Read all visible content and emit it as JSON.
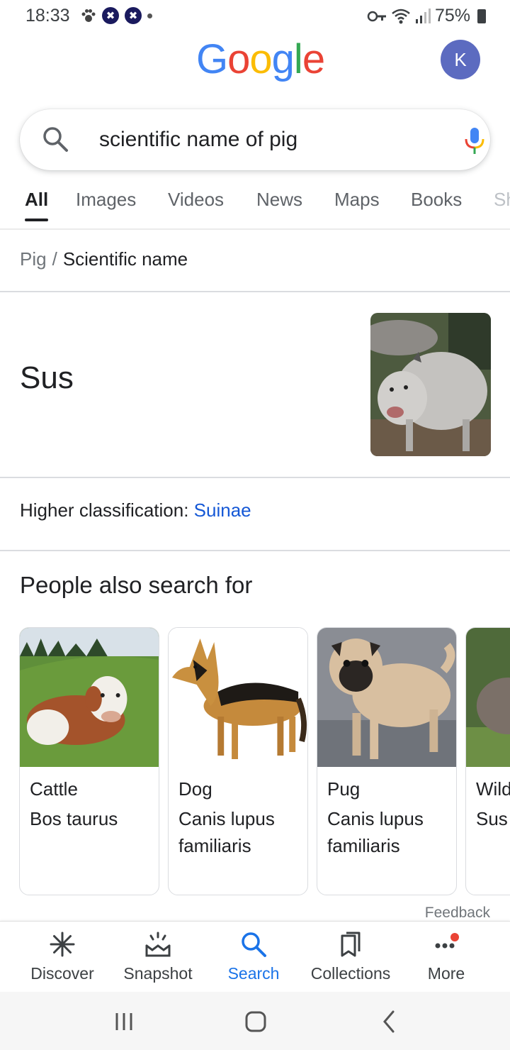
{
  "status_bar": {
    "time": "18:33",
    "battery": "75%"
  },
  "header": {
    "logo_letters": [
      "G",
      "o",
      "o",
      "g",
      "l",
      "e"
    ],
    "avatar_initial": "K"
  },
  "search": {
    "query": "scientific name of pig"
  },
  "tabs": [
    {
      "label": "All",
      "active": true
    },
    {
      "label": "Images"
    },
    {
      "label": "Videos"
    },
    {
      "label": "News"
    },
    {
      "label": "Maps"
    },
    {
      "label": "Books"
    },
    {
      "label": "Sh"
    }
  ],
  "breadcrumb": {
    "parent": "Pig",
    "separator": "/",
    "current": "Scientific name"
  },
  "answer": {
    "value": "Sus"
  },
  "classification": {
    "label": "Higher classification:",
    "value": "Suinae"
  },
  "people_also_search": {
    "title": "People also search for",
    "items": [
      {
        "name": "Cattle",
        "scientific": "Bos taurus"
      },
      {
        "name": "Dog",
        "scientific": "Canis lupus familiaris"
      },
      {
        "name": "Pug",
        "scientific": "Canis lupus familiaris"
      },
      {
        "name": "Wild",
        "scientific": "Sus"
      }
    ]
  },
  "feedback": "Feedback",
  "bottom_nav": [
    {
      "label": "Discover",
      "icon": "asterisk-icon"
    },
    {
      "label": "Snapshot",
      "icon": "snapshot-icon"
    },
    {
      "label": "Search",
      "icon": "search-icon",
      "active": true
    },
    {
      "label": "Collections",
      "icon": "bookmark-icon"
    },
    {
      "label": "More",
      "icon": "more-dots-icon"
    }
  ],
  "colors": {
    "google_blue": "#4285F4",
    "google_red": "#EA4335",
    "google_yellow": "#FBBC05",
    "google_green": "#34A853",
    "link": "#1558d6",
    "active_nav": "#1a73e8",
    "avatar": "#5c6bc0"
  }
}
